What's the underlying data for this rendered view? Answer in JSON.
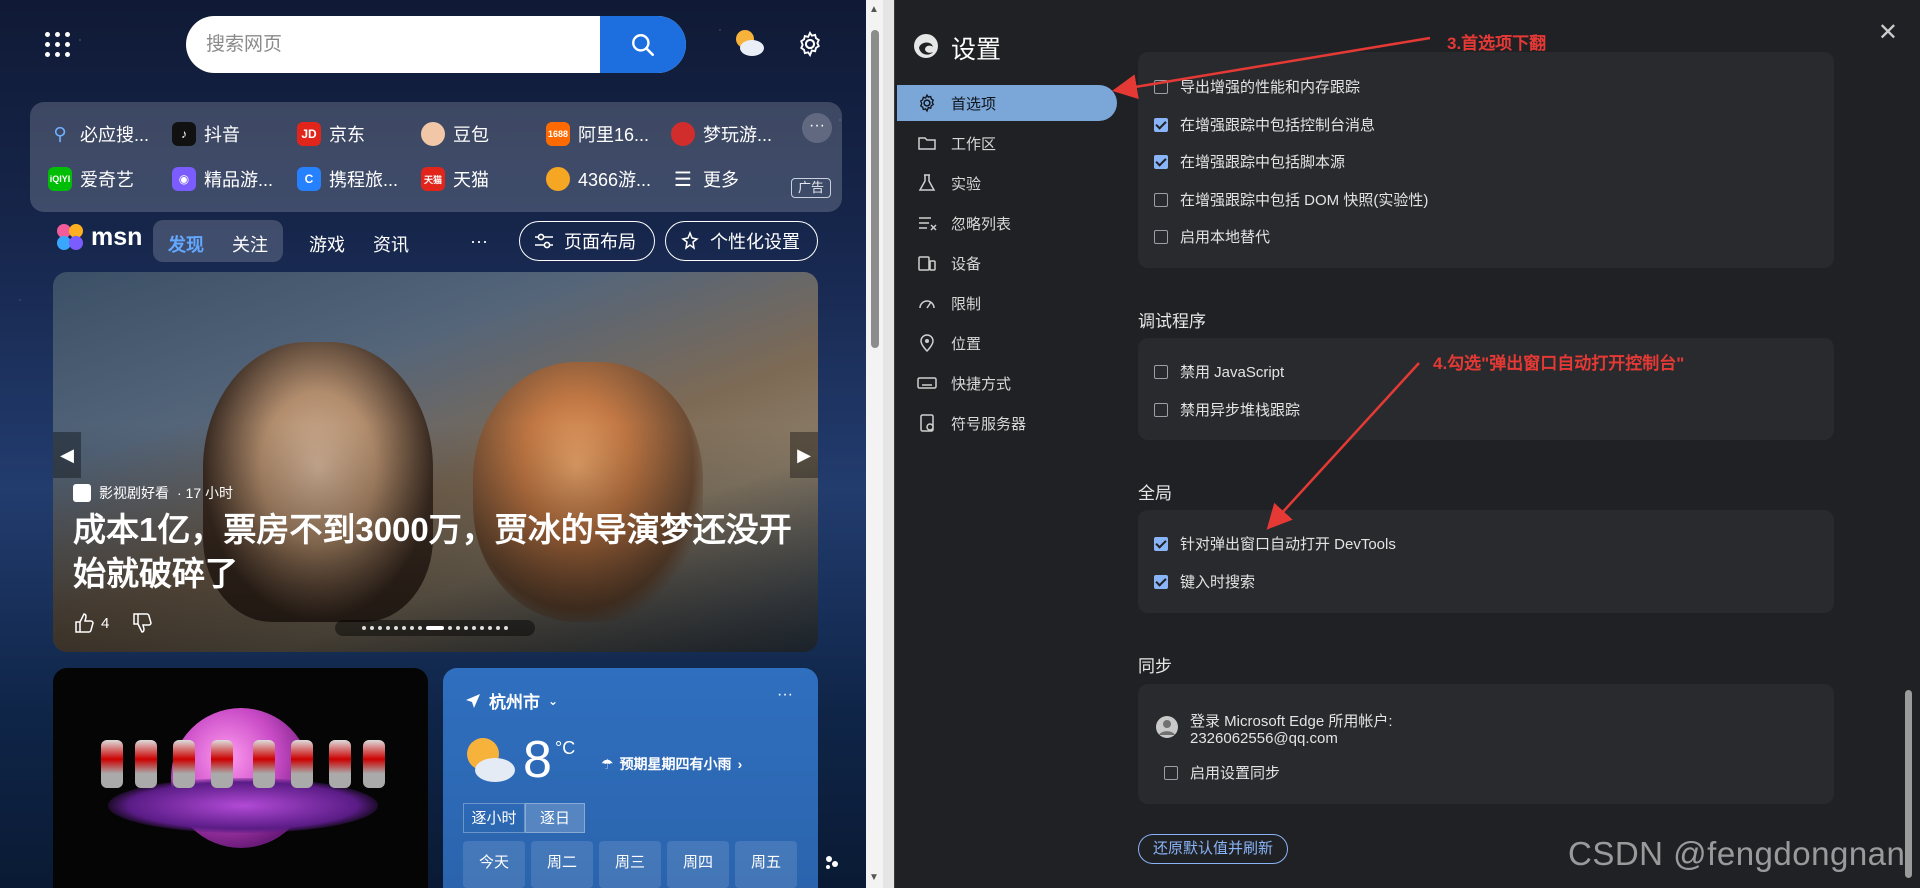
{
  "msn": {
    "search_placeholder": "搜索网页",
    "quick_links": [
      {
        "label": "必应搜...",
        "icon": "bing-search-icon",
        "color": "#1e6fd9"
      },
      {
        "label": "抖音",
        "icon": "douyin-icon",
        "color": "#111111"
      },
      {
        "label": "京东",
        "icon": "jd-icon",
        "color": "#e1251b"
      },
      {
        "label": "豆包",
        "icon": "doubao-icon",
        "color": "#f2c7a8"
      },
      {
        "label": "阿里16...",
        "icon": "alibaba-1688-icon",
        "color": "#ff6a00"
      },
      {
        "label": "梦玩游...",
        "icon": "game-icon",
        "color": "#d22d2d"
      },
      {
        "label": "爱奇艺",
        "icon": "iqiyi-icon",
        "color": "#00be06"
      },
      {
        "label": "精品游...",
        "icon": "gamepad-icon",
        "color": "#7b5cff"
      },
      {
        "label": "携程旅...",
        "icon": "ctrip-icon",
        "color": "#2681ff"
      },
      {
        "label": "天猫",
        "icon": "tmall-icon",
        "color": "#e1251b"
      },
      {
        "label": "4366游...",
        "icon": "cat-game-icon",
        "color": "#f5a623"
      },
      {
        "label": "更多",
        "icon": "menu-icon",
        "color": "#ffffff"
      }
    ],
    "ad_badge": "广告",
    "logo_text": "msn",
    "tabs": [
      "发现",
      "关注",
      "游戏",
      "资讯"
    ],
    "more": "···",
    "layout_button": "页面布局",
    "personalize_button": "个性化设置",
    "hero": {
      "source": "影视剧好看",
      "time": " · 17 小时",
      "title": "成本1亿，票房不到3000万，贾冰的导演梦还没开始就破碎了",
      "likes": "4"
    },
    "weather": {
      "city": "杭州市",
      "temp": "8",
      "unit": "°C",
      "forecast": "预期星期四有小雨",
      "tab_hourly": "逐小时",
      "tab_daily": "逐日",
      "days": [
        "今天",
        "周二",
        "周三",
        "周四",
        "周五"
      ]
    }
  },
  "settings": {
    "title": "设置",
    "nav": [
      "首选项",
      "工作区",
      "实验",
      "忽略列表",
      "设备",
      "限制",
      "位置",
      "快捷方式",
      "符号服务器"
    ],
    "group1": [
      {
        "label": "导出增强的性能和内存跟踪",
        "checked": false
      },
      {
        "label": "在增强跟踪中包括控制台消息",
        "checked": true
      },
      {
        "label": "在增强跟踪中包括脚本源",
        "checked": true
      },
      {
        "label": "在增强跟踪中包括 DOM 快照(实验性)",
        "checked": false
      },
      {
        "label": "启用本地替代",
        "checked": false
      }
    ],
    "debugger_title": "调试程序",
    "debugger": [
      {
        "label": "禁用 JavaScript",
        "checked": false
      },
      {
        "label": "禁用异步堆栈跟踪",
        "checked": false
      }
    ],
    "global_title": "全局",
    "global": [
      {
        "label": "针对弹出窗口自动打开 DevTools",
        "checked": true
      },
      {
        "label": "键入时搜索",
        "checked": true
      }
    ],
    "sync_title": "同步",
    "sync_account_line1": "登录 Microsoft Edge 所用帐户:",
    "sync_account_line2": "2326062556@qq.com",
    "sync_enable": {
      "label": "启用设置同步",
      "checked": false
    },
    "reset_button": "还原默认值并刷新"
  },
  "annotations": {
    "a3": "3.首选项下翻",
    "a4": "4.勾选\"弹出窗口自动打开控制台\""
  },
  "watermark": "CSDN @fengdongnan"
}
